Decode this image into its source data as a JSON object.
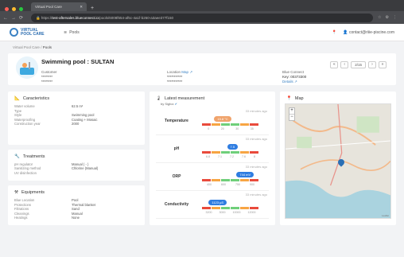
{
  "browser": {
    "tab_title": "Virtual Pool Care",
    "url_prefix": "https://",
    "url_host": "test-aftersales.blueconnect.io",
    "url_path": "/pools/6008f654-af5c-4a1f-b260-a3aee377f150"
  },
  "app": {
    "logo_top": "VIRTUAL",
    "logo_bottom": "POOL CARE",
    "nav_pools": "Pools",
    "user_email": "contact@riiie-piscine.com"
  },
  "breadcrumb": {
    "root": "Virtual Pool Care",
    "sep": "/",
    "current": "Pools"
  },
  "pool": {
    "title": "Swimming pool : SULTAN",
    "customer_label": "Customer",
    "customer_line1": "********",
    "customer_line2": "********",
    "location_label": "Location",
    "location_link": "Map",
    "location_line1": "***********",
    "location_line2": "***********",
    "blue_label": "Blue Connect",
    "blue_key": "Key: 00373300",
    "blue_details": "Details",
    "pager": "2/15"
  },
  "characteristics": {
    "title": "Caracteristics",
    "rows": [
      {
        "k": "Water volume",
        "v": "62.5 m³"
      },
      {
        "k": "Type",
        "v": ""
      },
      {
        "k": "Style",
        "v": "Swimming pool"
      },
      {
        "k": "Waterproofing",
        "v": "Coating + Mosaic"
      },
      {
        "k": "Construction year",
        "v": "2000"
      }
    ]
  },
  "treatments": {
    "title": "Treatments",
    "rows": [
      {
        "k": "pH regulator",
        "v": "Manual ( - )"
      },
      {
        "k": "Sanitizing method",
        "v": "Chlorine (Manual)"
      },
      {
        "k": "UV disinfection",
        "v": ""
      }
    ]
  },
  "equipments": {
    "title": "Equipments",
    "rows": [
      {
        "k": "Blue Location",
        "v": "Pool"
      },
      {
        "k": "Protections",
        "v": "Thermal blanket"
      },
      {
        "k": "Filtrations",
        "v": "Sand"
      },
      {
        "k": "Cleanings",
        "v": "Manual"
      },
      {
        "k": "Heatings",
        "v": "None"
      }
    ]
  },
  "measurements": {
    "title": "Latest measurement",
    "subtitle": "by Sigfox",
    "items": [
      {
        "label": "Temperature",
        "ago": "33 minutes ago",
        "value": "15.8 °C",
        "color": "#f0a36b",
        "pos": 0.22,
        "ticks": [
          "0",
          "20",
          "30",
          "35"
        ]
      },
      {
        "label": "pH",
        "ago": "33 minutes ago",
        "value": "7.5",
        "color": "#2f7de1",
        "pos": 0.45,
        "ticks": [
          "6.8",
          "7.1",
          "7.2",
          "7.6",
          "8"
        ]
      },
      {
        "label": "ORP",
        "ago": "33 minutes ago",
        "value": "744 mV",
        "color": "#2f7de1",
        "pos": 0.62,
        "ticks": [
          "400",
          "600",
          "750",
          "900"
        ]
      },
      {
        "label": "Conductivity",
        "ago": "33 minutes ago",
        "value": "1123 µS",
        "color": "#2f7de1",
        "pos": 0.12,
        "ticks": [
          "3200",
          "3000",
          "10000",
          "12000"
        ]
      }
    ]
  },
  "map": {
    "title": "Map",
    "attribution": "Leaflet"
  }
}
